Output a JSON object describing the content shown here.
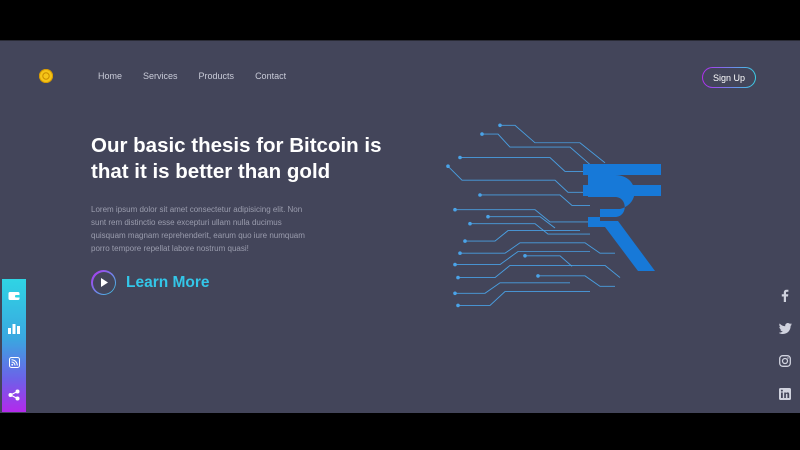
{
  "brand": {
    "logo_icon": "coin-icon",
    "accent_gold": "#f5c518"
  },
  "nav": {
    "items": [
      {
        "label": "Home"
      },
      {
        "label": "Services"
      },
      {
        "label": "Products"
      },
      {
        "label": "Contact"
      }
    ]
  },
  "header": {
    "signup_label": "Sign Up"
  },
  "hero": {
    "headline": "Our basic thesis for Bitcoin is that it is better than gold",
    "description": "Lorem ipsum dolor sit amet consectetur adipisicing elit. Non sunt rem distinctio esse excepturi ullam nulla ducimus quisquam magnam reprehenderit, earum quo iure numquam porro tempore repellat labore nostrum quasi!",
    "cta_label": "Learn More",
    "illustration_icon": "rupee-circuit-icon"
  },
  "sidebar": {
    "icons": [
      "wallet-icon",
      "bar-chart-icon",
      "rss-icon",
      "share-icon"
    ]
  },
  "social": {
    "icons": [
      "facebook-icon",
      "twitter-icon",
      "instagram-icon",
      "linkedin-icon"
    ]
  },
  "colors": {
    "background": "#43455a",
    "accent_cyan": "#33c6e8",
    "accent_purple": "#b32cf0",
    "circuit_blue": "#4aa3e8",
    "rupee_blue": "#1779d8"
  }
}
